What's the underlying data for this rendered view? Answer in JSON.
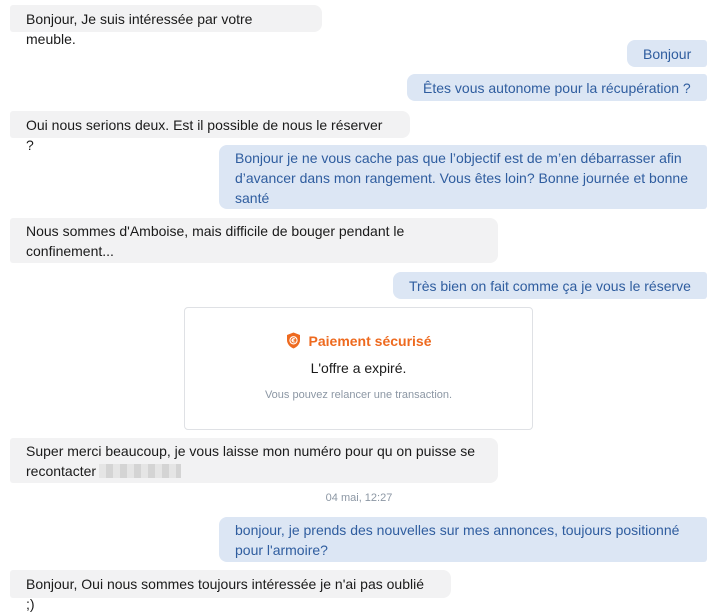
{
  "messages": [
    {
      "dir": "in",
      "text": "Bonjour, Je suis intéressée par votre meuble."
    },
    {
      "dir": "out",
      "text": "Bonjour"
    },
    {
      "dir": "out",
      "text": "Êtes vous autonome pour la récupération ?"
    },
    {
      "dir": "in",
      "text": "Oui nous serions deux. Est il possible de nous le réserver ?"
    },
    {
      "dir": "out",
      "text": "Bonjour je ne vous cache pas que l’objectif est de m’en débarrasser afin d’avancer dans mon rangement. Vous êtes loin? Bonne journée et bonne santé"
    },
    {
      "dir": "in",
      "text": "Nous sommes d'Amboise, mais difficile de bouger pendant le confinement..."
    },
    {
      "dir": "out",
      "text": "Très bien on fait comme ça je vous le réserve"
    },
    {
      "dir": "in",
      "text": "Super merci beaucoup, je vous laisse mon numéro pour qu on puisse se recontacter"
    },
    {
      "dir": "out",
      "text": "bonjour, je prends des nouvelles sur mes annonces, toujours positionné pour l'armoire?"
    },
    {
      "dir": "in",
      "text": "Bonjour, Oui nous sommes toujours intéressée je n'ai pas oublié ;)"
    }
  ],
  "payment_card": {
    "title": "Paiement sécurisé",
    "status": "L'offre a expiré.",
    "subtitle": "Vous pouvez relancer une transaction.",
    "icon": "shield-euro-icon",
    "accent_color": "#ee6a1f"
  },
  "timestamp": "04 mai, 12:27",
  "colors": {
    "incoming_bg": "#f2f2f3",
    "outgoing_bg": "#dce6f4",
    "outgoing_text": "#2f5d9f",
    "muted_text": "#8c97a4"
  }
}
